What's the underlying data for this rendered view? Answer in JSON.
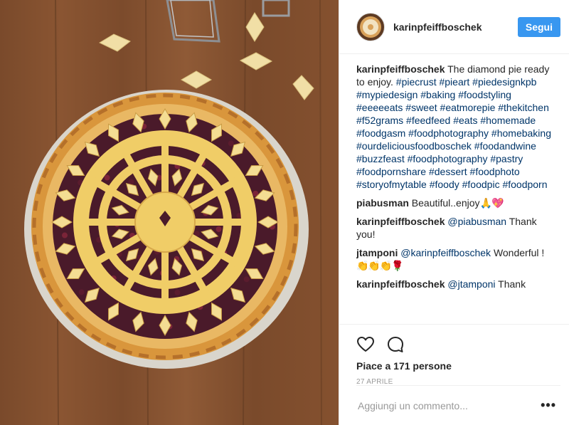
{
  "post": {
    "image_alt": "Diamond lattice pie on wooden table",
    "author": "karinpfeiffboschek",
    "follow_label": "Segui",
    "caption": {
      "user": "karinpfeiffboschek",
      "text": "The diamond pie ready to enjoy.",
      "hashtags": "#piecrust #pieart #piedesignkpb #mypiedesign #baking #foodstyling #eeeeeats #sweet #eatmorepie #thekitchen #f52grams #feedfeed #eats #homemade #foodgasm #foodphotography #homebaking #ourdeliciousfoodboschek #foodandwine #buzzfeast #foodphotography #pastry #foodpornshare #dessert #foodphoto #storyofmytable #foody #foodpic #foodporn"
    },
    "comments": [
      {
        "user": "piabusman",
        "text": "Beautiful..enjoy",
        "emoji": "🙏💖"
      },
      {
        "user": "karinpfeiffboschek",
        "mention": "@piabusman",
        "text": "Thank you!"
      },
      {
        "user": "jtamponi",
        "mention": "@karinpfeiffboschek",
        "text": "Wonderful !",
        "emoji": "👏👏👏",
        "emoji2": "🌹"
      },
      {
        "user": "karinpfeiffboschek",
        "mention": "@jtamponi",
        "text": "Thank"
      }
    ],
    "likes_label": "Piace a 171 persone",
    "date_label": "27 APRILE",
    "comment_placeholder": "Aggiungi un commento...",
    "more_label": "•••",
    "icons": {
      "like": "heart-icon",
      "comment": "comment-bubble-icon",
      "more": "more-options-icon"
    },
    "colors": {
      "follow": "#3897f0",
      "hashtag": "#003569",
      "muted": "#999999"
    }
  }
}
